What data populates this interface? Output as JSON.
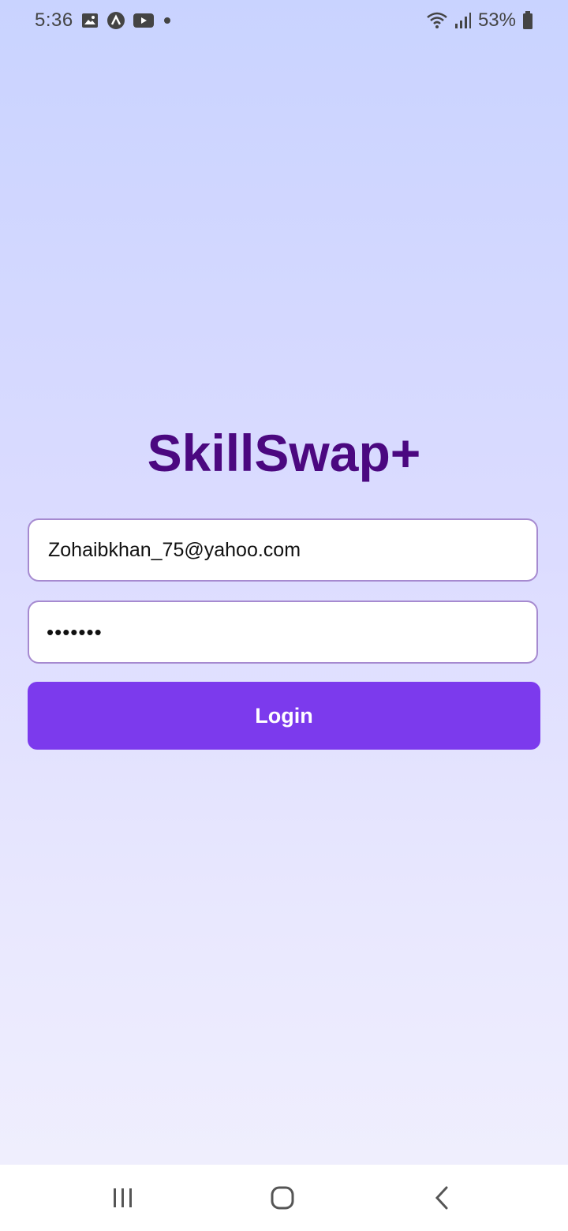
{
  "status_bar": {
    "time": "5:36",
    "left_icons": [
      "gallery-icon",
      "app-notification-icon",
      "youtube-icon",
      "dot-icon"
    ],
    "right_icons": [
      "wifi-icon",
      "signal-icon",
      "battery-icon"
    ],
    "battery_percent": "53%"
  },
  "app": {
    "title": "SkillSwap+"
  },
  "login_form": {
    "email_value": "Zohaibkhan_75@yahoo.com",
    "password_masked": "•••••••",
    "login_label": "Login"
  },
  "colors": {
    "title": "#4b0880",
    "button": "#7c3aed",
    "field_border": "#a68ad0",
    "background_top": "#c9d3ff",
    "background_bottom": "#f1f0fd"
  },
  "nav_bar": {
    "icons": [
      "recents-icon",
      "home-icon",
      "back-icon"
    ]
  }
}
